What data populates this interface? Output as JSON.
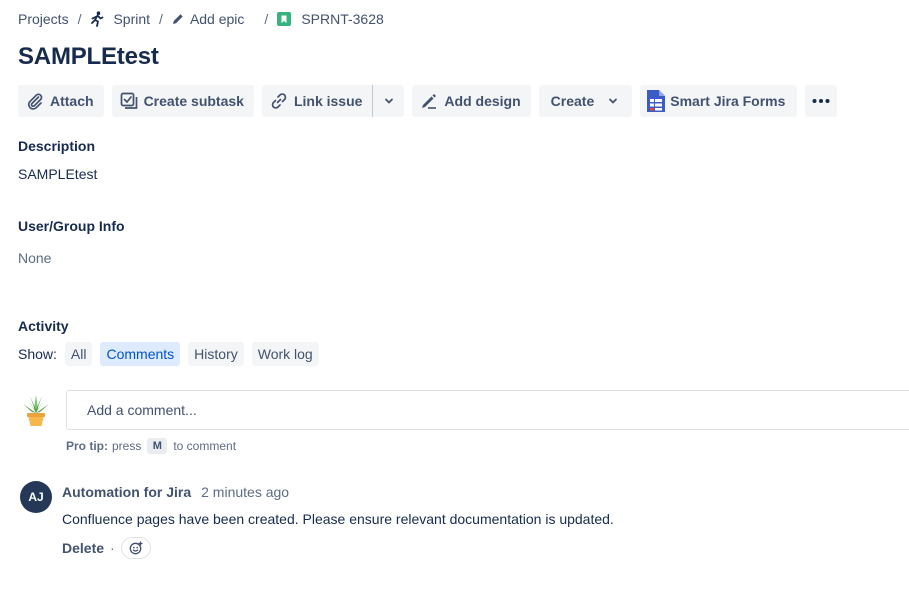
{
  "breadcrumbs": {
    "projects": "Projects",
    "sprint": "Sprint",
    "add_epic": "Add epic",
    "issue_key": "SPRNT-3628",
    "separator": "/"
  },
  "issue": {
    "title": "SAMPLEtest"
  },
  "toolbar": {
    "attach": "Attach",
    "create_subtask": "Create subtask",
    "link_issue": "Link issue",
    "add_design": "Add design",
    "create": "Create",
    "smart_jira_forms": "Smart Jira Forms"
  },
  "fields": {
    "description_label": "Description",
    "description_value": "SAMPLEtest",
    "user_group_label": "User/Group Info",
    "user_group_value": "None"
  },
  "activity": {
    "heading": "Activity",
    "show_label": "Show:",
    "filters": [
      {
        "label": "All",
        "active": false
      },
      {
        "label": "Comments",
        "active": true
      },
      {
        "label": "History",
        "active": false
      },
      {
        "label": "Work log",
        "active": false
      }
    ],
    "comment_placeholder": "Add a comment...",
    "protip_bold": "Pro tip:",
    "protip_press": "press",
    "protip_key": "M",
    "protip_suffix": "to comment"
  },
  "comments": [
    {
      "avatar_initials": "AJ",
      "author": "Automation for Jira",
      "time": "2 minutes ago",
      "body": "Confluence pages have been created. Please ensure relevant documentation is updated.",
      "delete_label": "Delete",
      "separator": "·"
    }
  ],
  "colors": {
    "accent": "#0052cc",
    "active_pill_bg": "#deebff",
    "button_bg": "#f4f5f7",
    "avatar_bg": "#253858",
    "story_icon": "#36b37e"
  },
  "icons": [
    "sprint-runner-icon",
    "pencil-icon",
    "story-bookmark-icon",
    "paperclip-icon",
    "subtask-check-icon",
    "link-icon",
    "chevron-down-icon",
    "design-icon",
    "smart-forms-icon",
    "more-icon",
    "plant-avatar-icon",
    "emoji-add-icon"
  ]
}
